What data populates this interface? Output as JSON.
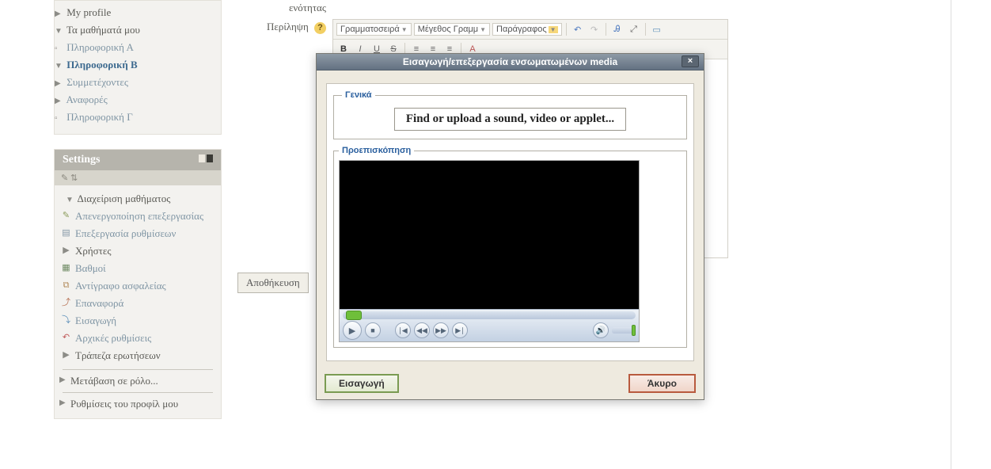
{
  "nav": {
    "my_profile": "My profile",
    "my_courses": "Τα μαθήματά μου",
    "course_a": "Πληροφορική Α",
    "course_b": "Πληροφορική Β",
    "participants": "Συμμετέχοντες",
    "reports": "Αναφορές",
    "course_c": "Πληροφορική Γ"
  },
  "settings": {
    "title": "Settings",
    "course_admin": "Διαχείριση μαθήματος",
    "turn_editing_off": "Απενεργοποίηση επεξεργασίας",
    "edit_settings": "Επεξεργασία ρυθμίσεων",
    "users": "Χρήστες",
    "grades": "Βαθμοί",
    "backup": "Αντίγραφο ασφαλείας",
    "restore": "Επαναφορά",
    "import": "Εισαγωγή",
    "reset": "Αρχικές ρυθμίσεις",
    "question_bank": "Τράπεζα ερωτήσεων",
    "switch_role": "Μετάβαση σε ρόλο...",
    "profile_settings": "Ρυθμίσεις του προφίλ μου"
  },
  "form": {
    "section_label": "ενότητας",
    "summary_label": "Περίληψη",
    "save_label": "Αποθήκευση"
  },
  "toolbar": {
    "font_family": "Γραμματοσειρά",
    "font_size": "Μέγεθος Γραμμ",
    "paragraph": "Παράγραφος"
  },
  "modal": {
    "title": "Εισαγωγή/επεξεργασία ενσωματωμένων media",
    "close": "×",
    "general_legend": "Γενικά",
    "find_label": "Find or upload a sound, video or applet...",
    "preview_legend": "Προεπισκόπηση",
    "insert_label": "Εισαγωγή",
    "cancel_label": "Άκυρο"
  }
}
